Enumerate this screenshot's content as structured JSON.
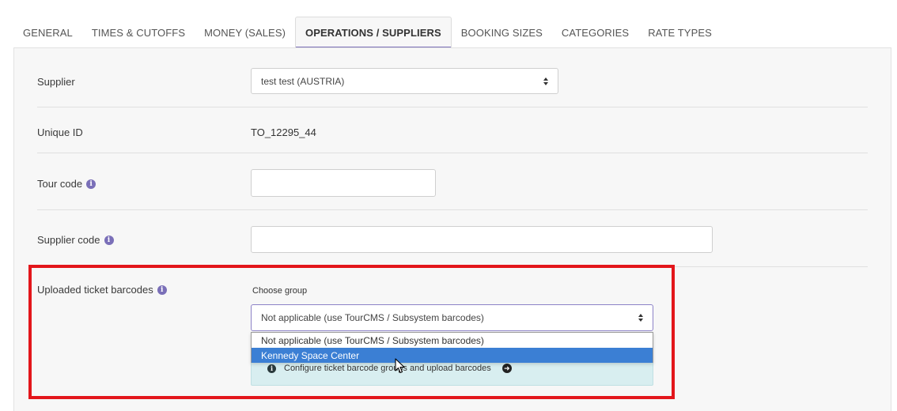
{
  "tabs": [
    {
      "label": "GENERAL",
      "active": false
    },
    {
      "label": "TIMES & CUTOFFS",
      "active": false
    },
    {
      "label": "MONEY (SALES)",
      "active": false
    },
    {
      "label": "OPERATIONS / SUPPLIERS",
      "active": true
    },
    {
      "label": "BOOKING SIZES",
      "active": false
    },
    {
      "label": "CATEGORIES",
      "active": false
    },
    {
      "label": "RATE TYPES",
      "active": false
    }
  ],
  "form": {
    "supplier": {
      "label": "Supplier",
      "value": "test test (AUSTRIA)"
    },
    "unique_id": {
      "label": "Unique ID",
      "value": "TO_12295_44"
    },
    "tour_code": {
      "label": "Tour code",
      "value": ""
    },
    "supplier_code": {
      "label": "Supplier code",
      "value": ""
    },
    "barcodes": {
      "label": "Uploaded ticket barcodes",
      "choose_group_label": "Choose group",
      "selected": "Not applicable (use TourCMS / Subsystem barcodes)",
      "options": [
        "Not applicable (use TourCMS / Subsystem barcodes)",
        "Kennedy Space Center"
      ],
      "highlighted_option": "Kennedy Space Center",
      "configure_link": "Configure ticket barcode groups and upload barcodes"
    }
  },
  "colors": {
    "accent": "#7a6fb8",
    "highlight_border": "#e3161b",
    "dropdown_selected": "#3b7fd4",
    "info_box_bg": "#d8eef0"
  },
  "icons": {
    "info": "info-icon",
    "select_arrows": "up-down-arrows-icon",
    "arrow_right": "arrow-circle-right-icon",
    "cursor": "mouse-pointer-icon"
  }
}
